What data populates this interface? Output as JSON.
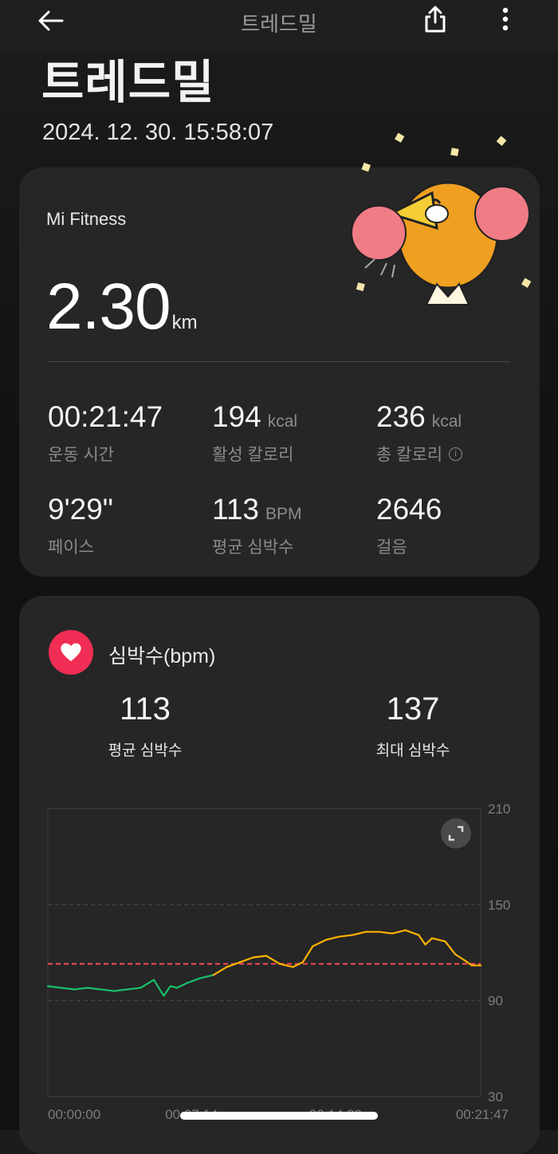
{
  "header": {
    "title": "트레드밀"
  },
  "page": {
    "title": "트레드밀",
    "datetime": "2024. 12. 30. 15:58:07"
  },
  "summary": {
    "source": "Mi Fitness",
    "distance": {
      "value": "2.30",
      "unit": "km"
    },
    "stats": [
      {
        "value": "00:21:47",
        "unit": "",
        "label": "운동 시간"
      },
      {
        "value": "194",
        "unit": "kcal",
        "label": "활성 칼로리"
      },
      {
        "value": "236",
        "unit": "kcal",
        "label": "총 칼로리"
      },
      {
        "value": "9'29\"",
        "unit": "",
        "label": "페이스"
      },
      {
        "value": "113",
        "unit": "BPM",
        "label": "평균 심박수"
      },
      {
        "value": "2646",
        "unit": "",
        "label": "걸음"
      }
    ]
  },
  "heart_rate": {
    "title": "심박수(bpm)",
    "avg": {
      "value": "113",
      "label": "평균 심박수"
    },
    "max": {
      "value": "137",
      "label": "최대 심박수"
    }
  },
  "colors": {
    "accent_red": "#f02d55",
    "avg_line": "#ff4d4d",
    "zone_low": "#18c06a",
    "zone_mid": "#ffb300",
    "zone_min": "#1fa6ff"
  },
  "chart_data": {
    "type": "line",
    "title": "",
    "xlabel": "",
    "ylabel": "",
    "ylim": [
      30,
      210
    ],
    "yticks": [
      "210",
      "150",
      "90",
      "30"
    ],
    "xtick_labels": [
      "00:00:00",
      "00:07:14",
      "00:14:29",
      "00:21:47"
    ],
    "average": 113,
    "grid": true,
    "series": [
      {
        "x": [
          "00:00:00",
          "00:00:40",
          "00:01:20",
          "00:02:00",
          "00:02:40",
          "00:03:20",
          "00:04:00",
          "00:04:40",
          "00:05:20",
          "00:05:50",
          "00:06:10",
          "00:06:30",
          "00:07:00",
          "00:07:40",
          "00:08:20",
          "00:09:00",
          "00:09:40",
          "00:10:20",
          "00:11:00",
          "00:11:40",
          "00:12:20",
          "00:12:50",
          "00:13:20",
          "00:14:00",
          "00:14:40",
          "00:15:20",
          "00:16:00",
          "00:16:40",
          "00:17:20",
          "00:18:00",
          "00:18:40",
          "00:19:00",
          "00:19:20",
          "00:19:40",
          "00:20:00",
          "00:20:30",
          "00:21:00",
          "00:21:20",
          "00:21:47"
        ],
        "values": [
          99,
          98,
          97,
          98,
          97,
          96,
          97,
          98,
          103,
          93,
          99,
          98,
          101,
          104,
          106,
          111,
          114,
          117,
          118,
          113,
          111,
          114,
          124,
          128,
          130,
          131,
          133,
          133,
          132,
          134,
          131,
          125,
          129,
          128,
          127,
          119,
          115,
          112,
          112
        ]
      }
    ]
  }
}
